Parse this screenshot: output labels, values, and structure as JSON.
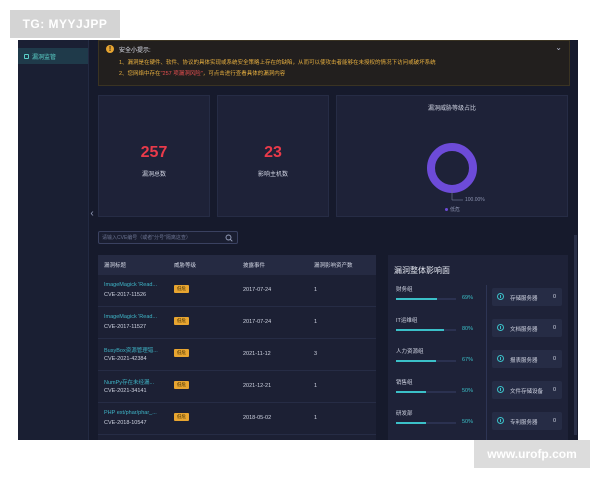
{
  "watermark": {
    "top_left": "TG: MYYJJPP",
    "bottom_right": "www.urofp.com"
  },
  "sidebar": {
    "items": [
      {
        "label": "漏洞监管"
      }
    ]
  },
  "tip": {
    "title": "安全小提示:",
    "line1": "1、漏洞是在硬件、软件、协议的具体实现或系统安全策略上存在的缺陷，从而可以使攻击者能够在未授权的情况下访问或破坏系统",
    "line2_prefix": "2、您网络中存在",
    "line2_highlight": "\"257 项漏洞风险\"",
    "line2_suffix": "，可点击进行查看具体的漏洞内容"
  },
  "stats": {
    "vuln_total": {
      "value": "257",
      "label": "漏洞总数"
    },
    "hosts_affected": {
      "value": "23",
      "label": "影响主机数"
    }
  },
  "donut": {
    "title": "漏洞威胁等级占比",
    "percent_label": "100.00%",
    "legend": "低危",
    "color": "#6d4bd8"
  },
  "search": {
    "placeholder": "请输入CVE编号（或者\"分号\"隔离这查）"
  },
  "table": {
    "headers": [
      "漏洞标题",
      "威胁等级",
      "披露事件",
      "漏洞影响资产数"
    ],
    "rows": [
      {
        "title": "ImageMagick 'Read...",
        "cve": "CVE-2017-11526",
        "level": "低危",
        "date": "2017-07-24",
        "count": "1"
      },
      {
        "title": "ImageMagick 'Read...",
        "cve": "CVE-2017-11527",
        "level": "低危",
        "date": "2017-07-24",
        "count": "1"
      },
      {
        "title": "BusyBox资源管理错...",
        "cve": "CVE-2021-42384",
        "level": "低危",
        "date": "2021-11-12",
        "count": "3"
      },
      {
        "title": "NumPy存在未经漏...",
        "cve": "CVE-2021-34141",
        "level": "低危",
        "date": "2021-12-21",
        "count": "1"
      },
      {
        "title": "PHP ext/phar/phar_...",
        "cve": "CVE-2018-10547",
        "level": "低危",
        "date": "2018-05-02",
        "count": "1"
      }
    ]
  },
  "impact": {
    "title": "漏洞整体影响面",
    "departments": [
      {
        "name": "财务组",
        "percent": "69%",
        "value": 0.69
      },
      {
        "name": "IT运维组",
        "percent": "80%",
        "value": 0.8
      },
      {
        "name": "人力资源组",
        "percent": "67%",
        "value": 0.67
      },
      {
        "name": "销售组",
        "percent": "50%",
        "value": 0.5
      },
      {
        "name": "研发部",
        "percent": "50%",
        "value": 0.5
      }
    ],
    "servers": [
      {
        "name": "存储服务器",
        "count": "0"
      },
      {
        "name": "文档服务器",
        "count": "0"
      },
      {
        "name": "报表服务器",
        "count": "0"
      },
      {
        "name": "文件存储设备",
        "count": "0"
      },
      {
        "name": "专利服务器",
        "count": "0"
      }
    ]
  }
}
